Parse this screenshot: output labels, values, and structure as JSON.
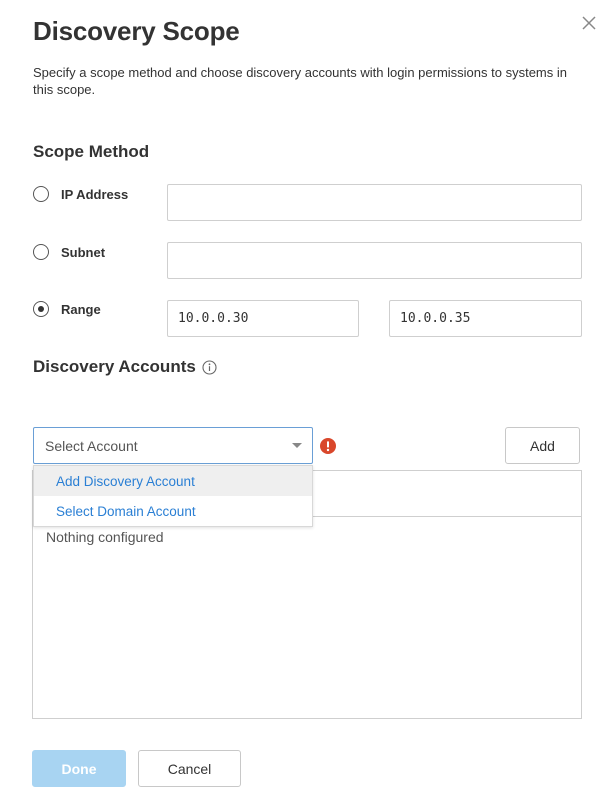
{
  "dialog": {
    "title": "Discovery Scope",
    "description": "Specify a scope method and choose discovery accounts with login permissions to systems in this scope."
  },
  "scope_method": {
    "heading": "Scope Method",
    "options": [
      {
        "label": "IP Address",
        "checked": false,
        "value": ""
      },
      {
        "label": "Subnet",
        "checked": false,
        "value": ""
      },
      {
        "label": "Range",
        "checked": true,
        "range_start": "10.0.0.30",
        "range_end": "10.0.0.35"
      }
    ]
  },
  "discovery_accounts": {
    "heading": "Discovery Accounts",
    "select_placeholder": "Select Account",
    "dropdown_options": [
      "Add Discovery Account",
      "Select Domain Account"
    ],
    "add_label": "Add",
    "empty_text": "Nothing configured"
  },
  "footer": {
    "done_label": "Done",
    "cancel_label": "Cancel"
  },
  "colors": {
    "link_blue": "#2a7fd4",
    "done_disabled": "#a8d4f2",
    "error_red": "#d9472b",
    "select_border": "#6a9fd6"
  },
  "icons": {
    "close": "close-icon",
    "info": "info-icon",
    "error": "error-icon",
    "caret": "chevron-down-icon"
  }
}
